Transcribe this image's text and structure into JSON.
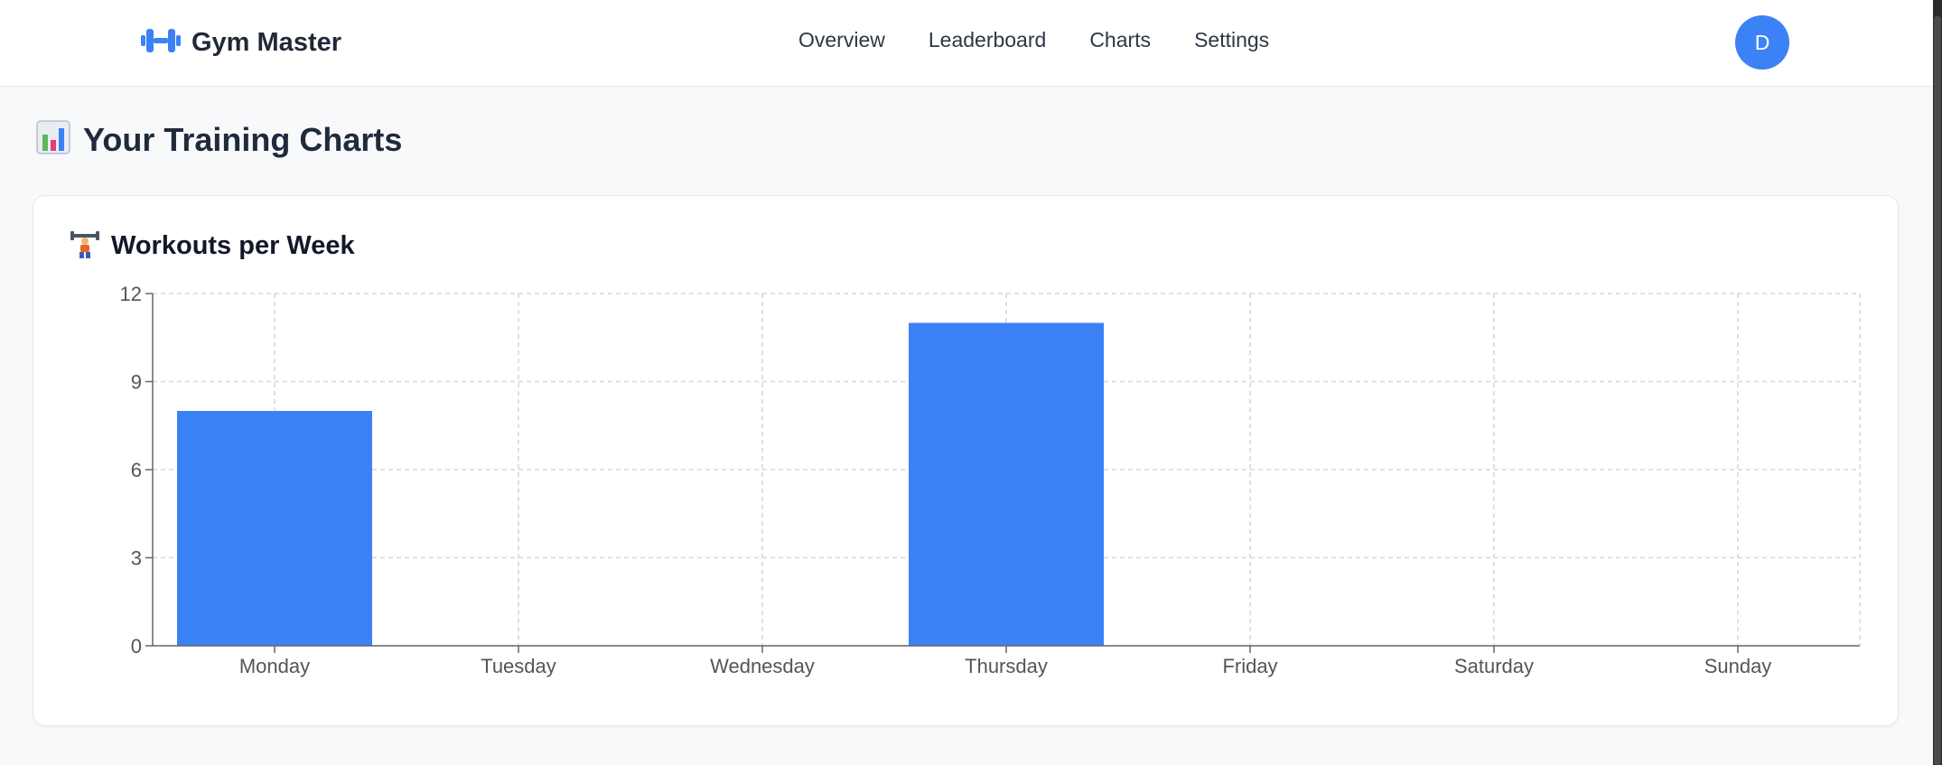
{
  "brand": {
    "name": "Gym Master",
    "icon": "dumbbell-icon",
    "accent": "#3b82f6"
  },
  "nav": {
    "items": [
      "Overview",
      "Leaderboard",
      "Charts",
      "Settings"
    ]
  },
  "user": {
    "avatar_initial": "D",
    "avatar_color": "#3b82f6"
  },
  "page": {
    "title": "Your Training Charts",
    "title_icon": "bar-chart-icon"
  },
  "card": {
    "title": "Workouts per Week",
    "title_icon": "weightlifter-icon"
  },
  "chart_data": {
    "type": "bar",
    "categories": [
      "Monday",
      "Tuesday",
      "Wednesday",
      "Thursday",
      "Friday",
      "Saturday",
      "Sunday"
    ],
    "values": [
      8,
      0,
      0,
      11,
      0,
      0,
      0
    ],
    "ylim": [
      0,
      12
    ],
    "yticks": [
      0,
      3,
      6,
      9,
      12
    ],
    "grid": true,
    "bar_color": "#3b82f6"
  }
}
